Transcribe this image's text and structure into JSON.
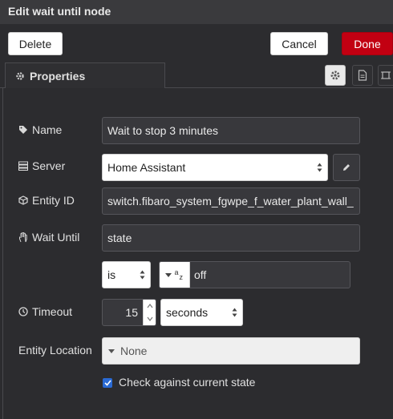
{
  "dialog": {
    "title": "Edit wait until node",
    "delete_label": "Delete",
    "cancel_label": "Cancel",
    "done_label": "Done"
  },
  "tabs": {
    "properties_label": "Properties",
    "icons": [
      "gear-icon",
      "document-icon",
      "frame-icon"
    ]
  },
  "form": {
    "name": {
      "label": "Name",
      "value": "Wait to stop 3 minutes"
    },
    "server": {
      "label": "Server",
      "value": "Home Assistant"
    },
    "entity_id": {
      "label": "Entity ID",
      "value": "switch.fibaro_system_fgwpe_f_water_plant_wall_"
    },
    "wait_until": {
      "label": "Wait Until",
      "value": "state"
    },
    "comparator": {
      "value": "is",
      "type_glyph_a": "a",
      "type_glyph_z": "z",
      "compare_value": "off"
    },
    "timeout": {
      "label": "Timeout",
      "value": "15",
      "unit": "seconds"
    },
    "entity_location": {
      "label": "Entity Location",
      "value": "None"
    },
    "check_current_state": {
      "label": "Check against current state",
      "checked": true
    }
  },
  "colors": {
    "done": "#c20012",
    "checkbox": "#2a6ad4",
    "background": "#2c2c2f"
  }
}
